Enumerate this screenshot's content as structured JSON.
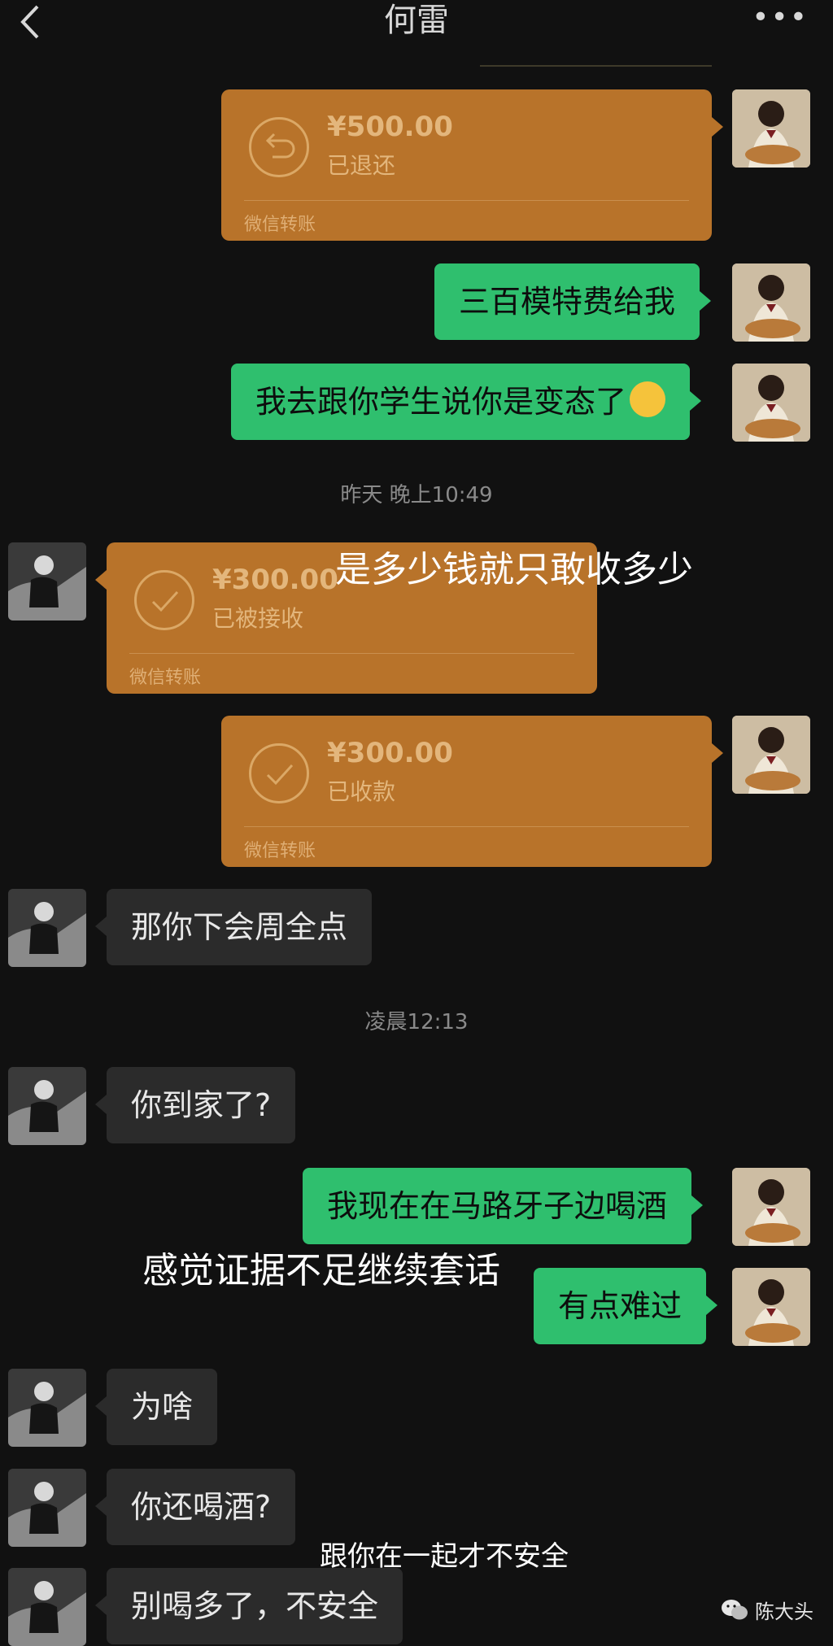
{
  "header": {
    "title": "何雷"
  },
  "messages": {
    "m1": {
      "amount": "¥500.00",
      "status": "已退还",
      "label": "微信转账"
    },
    "m2": {
      "text": "三百模特费给我"
    },
    "m3": {
      "text": "我去跟你学生说你是变态了"
    },
    "t1": "昨天 晚上10:49",
    "m4": {
      "amount": "¥300.00",
      "status": "已被接收",
      "label": "微信转账"
    },
    "m5": {
      "amount": "¥300.00",
      "status": "已收款",
      "label": "微信转账"
    },
    "m6": {
      "text": "那你下会周全点"
    },
    "t2": "凌晨12:13",
    "m7": {
      "text": "你到家了?"
    },
    "m8": {
      "text": "我现在在马路牙子边喝酒"
    },
    "m9": {
      "text": "有点难过"
    },
    "m10": {
      "text": "为啥"
    },
    "m11": {
      "text": "你还喝酒?"
    },
    "m12": {
      "text": "别喝多了，不安全"
    }
  },
  "overlays": {
    "o1": "是多少钱就只敢收多少",
    "o2": "感觉证据不足继续套话",
    "o3": "跟你在一起才不安全"
  },
  "watermark": {
    "text": "陈大头",
    "icon": "wechat-icon"
  }
}
